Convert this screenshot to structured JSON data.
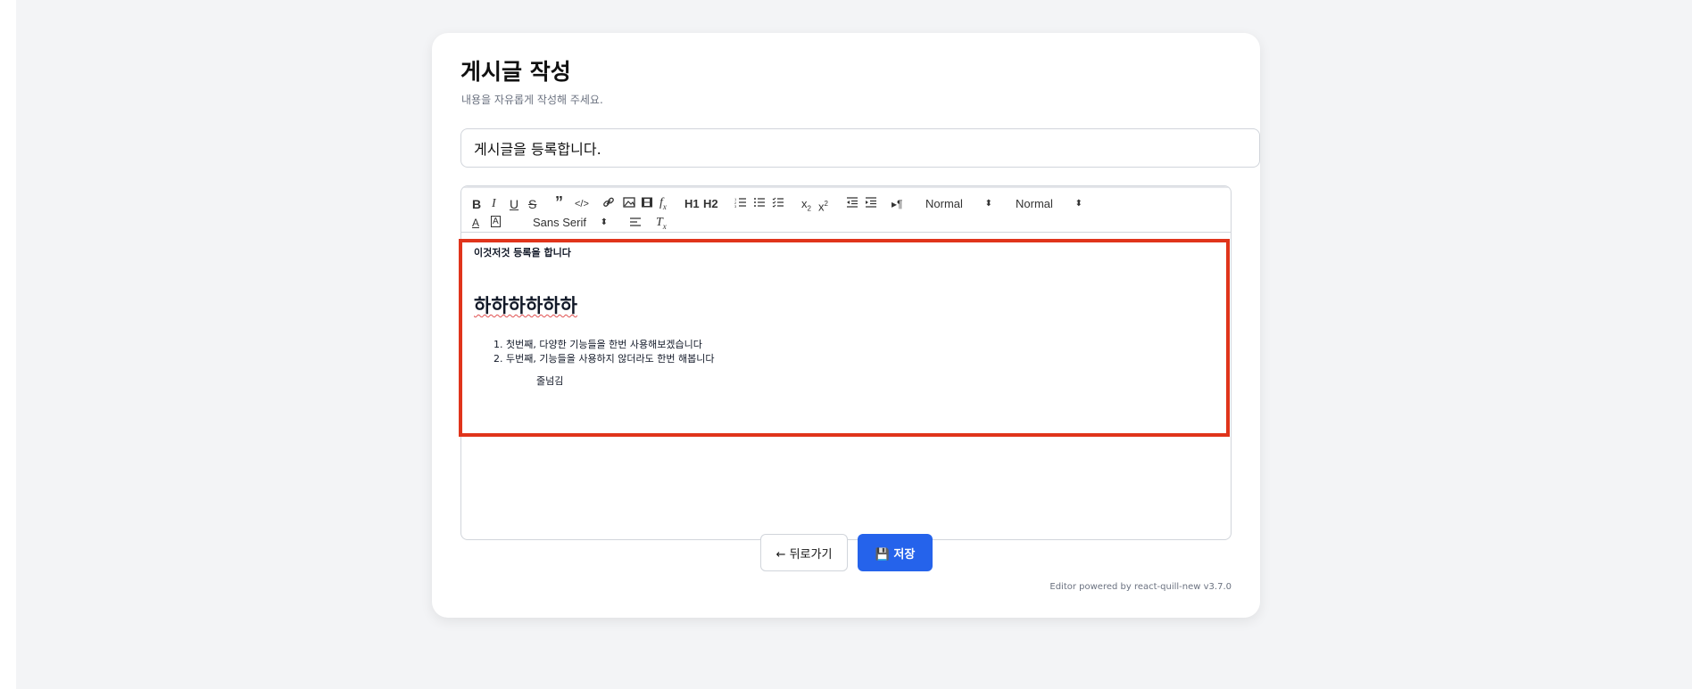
{
  "page": {
    "title": "게시글 작성",
    "subtitle": "내용을 자유롭게 작성해 주세요.",
    "title_input_value": "게시글을 등록합니다.",
    "footer": "Editor powered by react-quill-new v3.7.0"
  },
  "toolbar": {
    "header_label_1": "H1",
    "header_label_2": "H2",
    "size_picker_value": "Normal",
    "header_picker_value": "Normal",
    "font_picker_value": "Sans Serif"
  },
  "content": {
    "bold_line": "이것저것 등록을 합니다",
    "heading": "하하하하하하",
    "list_items": [
      "1. 첫번째, 다양한 기능들을 한번 사용해보겠습니다",
      "2. 두번째, 기능들을 사용하지 않더라도 한번 해봅니다"
    ],
    "indented_line": "줄넘김"
  },
  "buttons": {
    "back_label": "← 뒤로가기",
    "save_label": "💾 저장"
  },
  "colors": {
    "primary": "#2563eb",
    "highlight": "#e0341b"
  }
}
